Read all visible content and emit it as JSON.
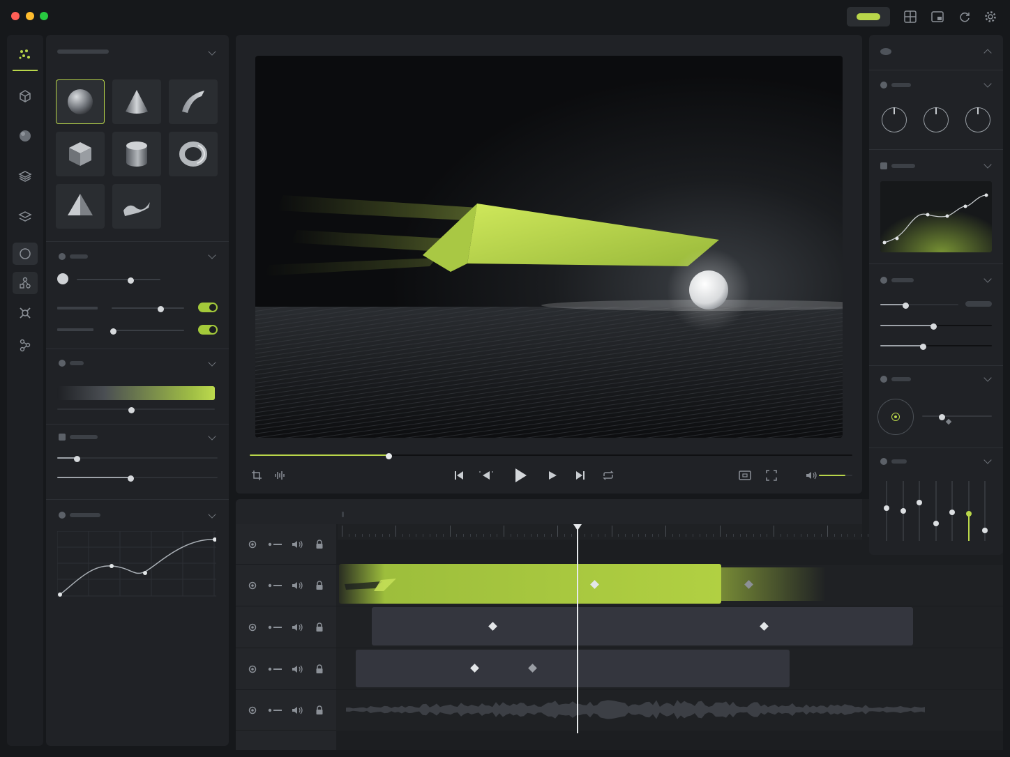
{
  "window": {
    "controls": [
      "close",
      "minimize",
      "maximize"
    ],
    "colors": {
      "close": "#ff5f57",
      "minimize": "#febc2e",
      "maximize": "#28c840",
      "accent": "#b9d64a"
    },
    "toolbar_icons": [
      "layout-grid-icon",
      "panel-icon",
      "refresh-icon",
      "gear-icon"
    ]
  },
  "tool_rail": {
    "items": [
      "shapes-icon",
      "cube-icon",
      "sphere-icon",
      "layers-icon",
      "stack-icon",
      "circle-icon",
      "nodes-icon",
      "target-icon",
      "share-icon"
    ],
    "active": 0
  },
  "left_panel": {
    "primitives": [
      "sphere",
      "cone",
      "curved-plane",
      "cube",
      "cylinder",
      "torus",
      "pyramid",
      "ribbon"
    ],
    "selected_primitive": 0,
    "toggles": [
      true,
      true
    ],
    "gradient": {
      "from": "#1f2125",
      "to": "#b6d64a"
    }
  },
  "viewport": {
    "progress": 0.23
  },
  "transport": {
    "left_icons": [
      "crop-icon",
      "audio-waveform-icon"
    ],
    "center_icons": [
      "skip-start-icon",
      "step-back-icon",
      "play-icon",
      "step-forward-icon",
      "skip-end-icon",
      "loop-icon"
    ],
    "right_icons": [
      "safe-frame-icon",
      "fullscreen-icon",
      "volume-icon"
    ],
    "volume": 0.8
  },
  "timeline": {
    "playhead": 0.36,
    "tracks": [
      {
        "type": "ruler"
      },
      {
        "type": "clip-accent"
      },
      {
        "type": "clip"
      },
      {
        "type": "clip"
      },
      {
        "type": "audio"
      }
    ]
  }
}
